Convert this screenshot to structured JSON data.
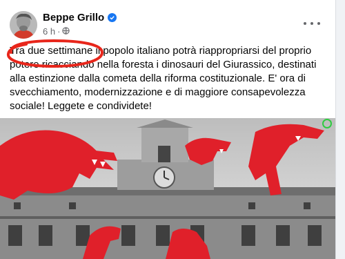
{
  "post": {
    "author": "Beppe Grillo",
    "time": "6 h",
    "separator": "·",
    "text": "Tra due settimane il popolo italiano potrà riappropriarsi del proprio potere ricacciando nella foresta i dinosauri del Giurassico, destinati alla estinzione dalla cometa della riforma costituzionale. E' ora di svecchiamento, modernizzazione e di maggiore consapevolezza sociale! Leggete e condividete!"
  },
  "colors": {
    "accent": "#1877f2",
    "annotation": "#e8261b",
    "dinosaur": "#e0202a"
  },
  "icons": {
    "verified": "verified-badge-icon",
    "privacy": "globe-icon",
    "menu": "more-horizontal-icon"
  }
}
